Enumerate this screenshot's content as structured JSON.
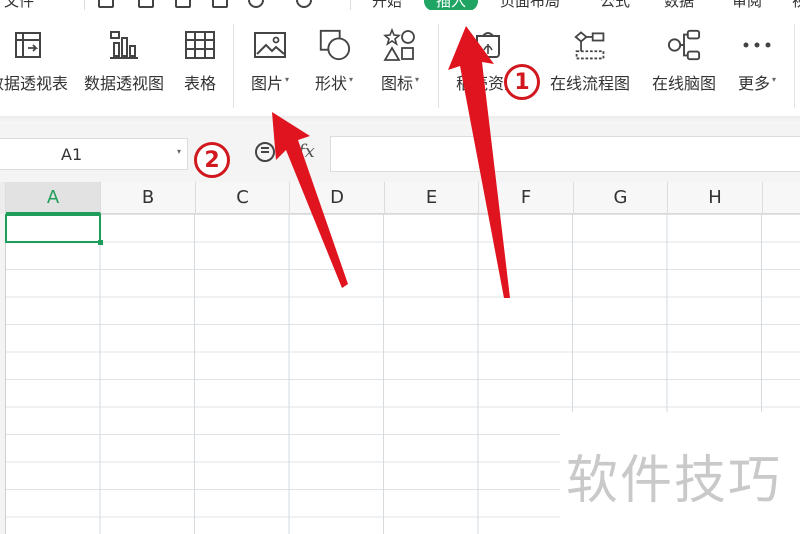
{
  "menu": {
    "items": [
      "文件",
      "开始",
      "插入",
      "页面布局",
      "公式",
      "数据",
      "审阅",
      "视图"
    ],
    "active": "插入"
  },
  "ribbon": {
    "buttons": [
      {
        "label": "数据透视表",
        "icon": "pivot-table-icon",
        "caret": false
      },
      {
        "label": "数据透视图",
        "icon": "pivot-chart-icon",
        "caret": false
      },
      {
        "label": "表格",
        "icon": "table-icon",
        "caret": false
      },
      {
        "label": "图片",
        "icon": "picture-icon",
        "caret": true
      },
      {
        "label": "形状",
        "icon": "shape-icon",
        "caret": true
      },
      {
        "label": "图标",
        "icon": "icon-library-icon",
        "caret": true
      },
      {
        "label": "稻壳资源",
        "icon": "docer-resource-icon",
        "caret": false
      },
      {
        "label": "在线流程图",
        "icon": "flowchart-icon",
        "caret": false
      },
      {
        "label": "在线脑图",
        "icon": "mindmap-icon",
        "caret": false
      },
      {
        "label": "更多",
        "icon": "more-icon",
        "caret": true
      }
    ]
  },
  "formula_bar": {
    "name_box_value": "A1",
    "fx_label": "fx",
    "formula_value": ""
  },
  "grid": {
    "columns": [
      "A",
      "B",
      "C",
      "D",
      "E",
      "F",
      "G",
      "H"
    ],
    "selected_column": "A",
    "active_cell": "A1"
  },
  "annotations": {
    "badge_1": "1",
    "badge_2": "2",
    "arrow_color": "#e0141e"
  },
  "watermark": "软件技巧",
  "colors": {
    "accent_green": "#1f9d5b",
    "menu_active_bg": "#1fa463",
    "annotation_red": "#d0181e"
  }
}
